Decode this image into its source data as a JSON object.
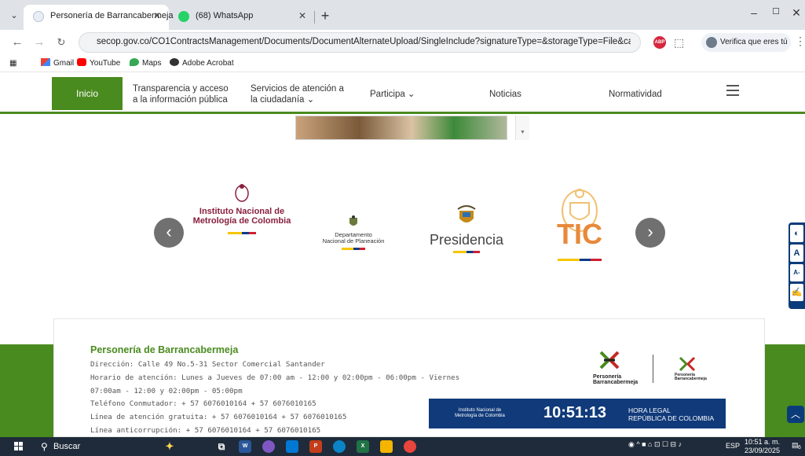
{
  "browser": {
    "tabs": [
      {
        "title": "Personería de Barrancabermeja",
        "active": true
      },
      {
        "title": "(68) WhatsApp",
        "active": false
      }
    ],
    "new_tab": "+",
    "url": "secop.gov.co/CO1ContractsManagement/Documents/DocumentAlternateUpload/SingleInclude?signatureType=&storageType=File&callbackUs...",
    "profile_chip": "Verifica que eres tú",
    "abp_label": "ABP",
    "window_controls": [
      "–",
      "☐",
      "✕"
    ]
  },
  "bookmarks": [
    {
      "label": "Gmail",
      "icon": "gmail-icon"
    },
    {
      "label": "YouTube",
      "icon": "youtube-icon"
    },
    {
      "label": "Maps",
      "icon": "maps-icon"
    },
    {
      "label": "Adobe Acrobat",
      "icon": "acrobat-icon"
    }
  ],
  "site_nav": {
    "inicio": "Inicio",
    "items": [
      {
        "label": "Transparencia y acceso\na la información pública"
      },
      {
        "label": "Servicios de atención a\nla ciudadanía ⌄"
      },
      {
        "label": "Participa ⌄"
      },
      {
        "label": "Noticias"
      },
      {
        "label": "Normatividad"
      }
    ]
  },
  "carousel": {
    "prev": "‹",
    "next": "›",
    "logos": [
      {
        "line1": "Instituto Nacional de",
        "line2": "Metrología de Colombia"
      },
      {
        "line1": "Departamento",
        "line2": "Nacional de Planeación"
      },
      {
        "line1": "Presidencia",
        "line2": ""
      },
      {
        "line1": "TIC",
        "line2": ""
      }
    ]
  },
  "accessibility": [
    "◐",
    "A",
    "A-",
    "✍"
  ],
  "footer": {
    "title": "Personería de Barrancabermeja",
    "lines": [
      "Dirección: Calle 49 No.5-31 Sector Comercial Santander",
      "Horario de atención: Lunes a Jueves de 07:00 am - 12:00 y 02:00pm - 06:00pm - Viernes",
      "07:00am - 12:00 y 02:00pm - 05:00pm",
      "Teléfono Conmutador: + 57 6076010164 + 57 6076010165",
      "Línea de atención gratuita: + 57 6076010164 + 57 6076010165",
      "Línea anticorrupción: + 57 6076010164 + 57 6076010165"
    ],
    "brand_large": "Personería\nBarrancabermeja",
    "brand_small": "Personería\nBarrancabermeja",
    "clock": {
      "institute": "Instituto Nacional de\nMetrología de Colombia",
      "time": "10:51:13",
      "label": "HORA LEGAL\nREPÚBLICA DE COLOMBIA"
    }
  },
  "taskbar": {
    "search": "Buscar",
    "lang": "ESP",
    "time": "10:51 a. m.",
    "date": "23/09/2025",
    "notifications": "6"
  }
}
